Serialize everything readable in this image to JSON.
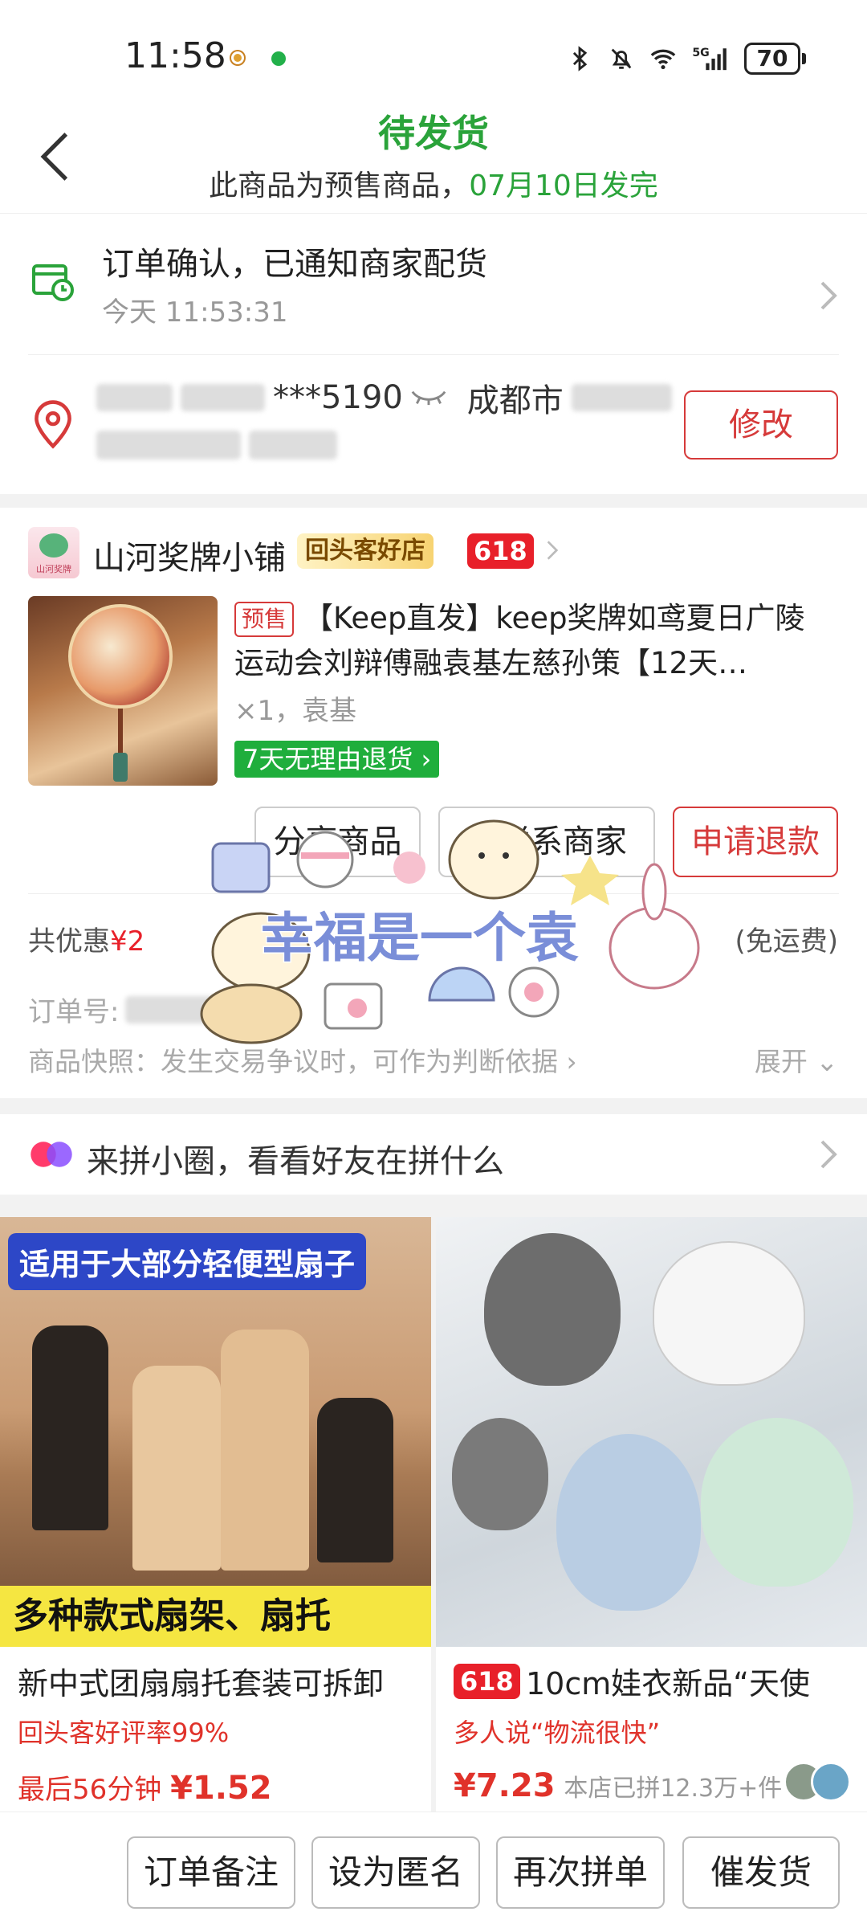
{
  "status_bar": {
    "time": "11:58",
    "battery": "70"
  },
  "header": {
    "title": "待发货",
    "subtitle_prefix": "此商品为预售商品，",
    "subtitle_date": "07月10日发完"
  },
  "tracking": {
    "title": "订单确认，已通知商家配货",
    "time": "今天 11:53:31"
  },
  "address": {
    "phone_visible": "***5190",
    "city": "成都市",
    "modify_label": "修改"
  },
  "shop": {
    "logo_text": "山河奖牌",
    "name": "山河奖牌小铺",
    "badge": "回头客好店",
    "tag": "618"
  },
  "product": {
    "presale_tag": "预售",
    "title": "【Keep直发】keep奖牌如鸢夏日广陵运动会刘辩傅融袁基左慈孙策【12天…",
    "spec": "×1，袁基",
    "return_tag": "7天无理由退货"
  },
  "actions": {
    "share": "分享商品",
    "contact": "联系商家",
    "refund": "申请退款"
  },
  "order": {
    "discount_label": "共优惠",
    "discount_value": "¥2",
    "freight": "(免运费)",
    "order_no_label": "订单号:",
    "snapshot": "商品快照：发生交易争议时，可作为判断依据",
    "expand": "展开"
  },
  "sticker_text": "幸福是一个袁",
  "circle": {
    "text": "来拼小圈，看看好友在拼什么"
  },
  "recommend": [
    {
      "banner": "适用于大部分轻便型扇子",
      "bottom_text": "多种款式扇架、扇托",
      "name": "新中式团扇扇托套装可拆卸",
      "note": "回头客好评率99%",
      "price_prefix": "最后56分钟",
      "price": "¥1.52"
    },
    {
      "tag": "618",
      "name": "10cm娃衣新品“天使",
      "note": "多人说“物流很快”",
      "price": "¥7.23",
      "sold": "本店已拼12.3万+件"
    }
  ],
  "bottom_bar": {
    "note": "订单备注",
    "anon": "设为匿名",
    "rebuy": "再次拼单",
    "urge": "催发货"
  },
  "colors": {
    "brand_green": "#2aa33a",
    "red": "#d63a3a",
    "price_red": "#e8202a"
  }
}
